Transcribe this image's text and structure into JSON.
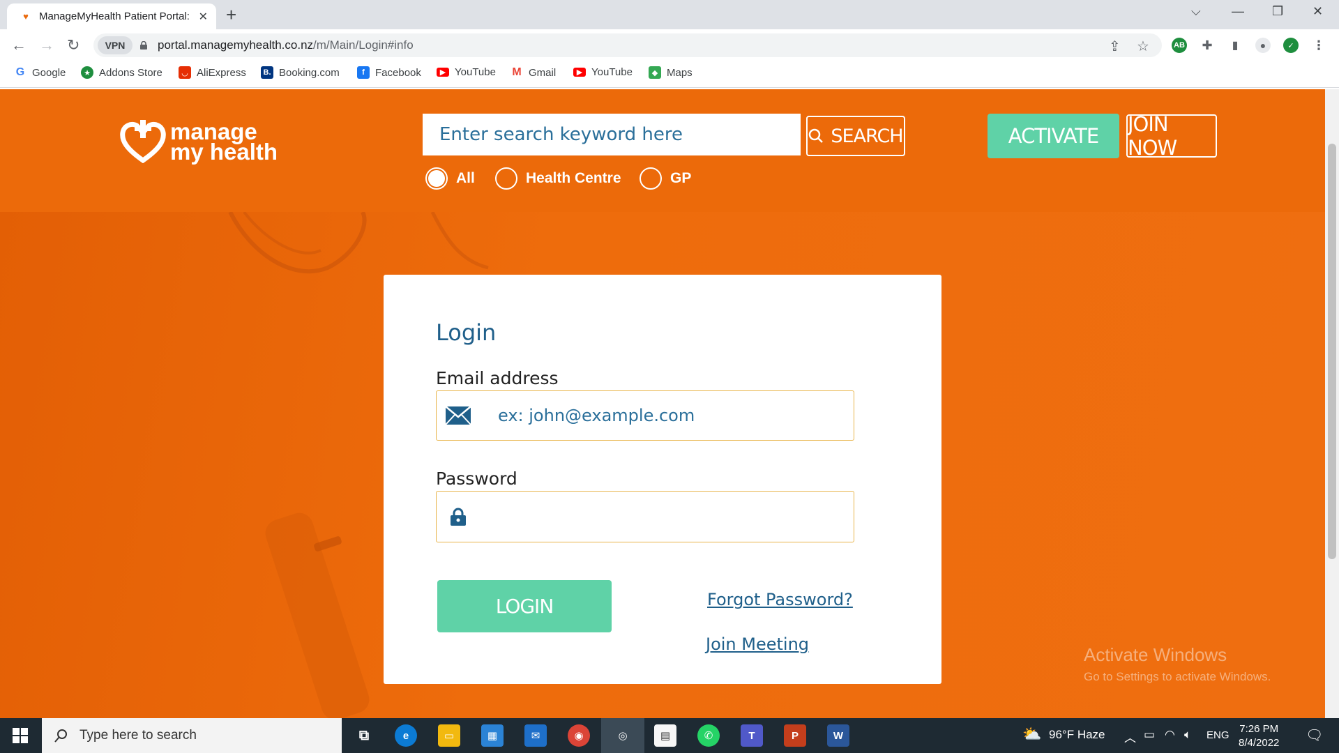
{
  "browser": {
    "tab_title": "ManageMyHealth Patient Portal:",
    "url_host": "portal.managemyhealth.co.nz",
    "url_path": "/m/Main/Login#info",
    "vpn_label": "VPN"
  },
  "bookmarks": [
    {
      "label": "Google",
      "icon": "google-icon",
      "color": "#4285f4"
    },
    {
      "label": "Addons Store",
      "icon": "addons-icon",
      "color": "#1e8e3e"
    },
    {
      "label": "AliExpress",
      "icon": "aliexpress-icon",
      "color": "#e62e04"
    },
    {
      "label": "Booking.com",
      "icon": "booking-icon",
      "color": "#003580"
    },
    {
      "label": "Facebook",
      "icon": "facebook-icon",
      "color": "#1877f2"
    },
    {
      "label": "YouTube",
      "icon": "youtube-icon",
      "color": "#ff0000"
    },
    {
      "label": "Gmail",
      "icon": "gmail-icon",
      "color": "#ea4335"
    },
    {
      "label": "YouTube",
      "icon": "youtube-icon",
      "color": "#ff0000"
    },
    {
      "label": "Maps",
      "icon": "maps-icon",
      "color": "#34a853"
    }
  ],
  "header": {
    "logo_line1": "manage",
    "logo_line2": "my health",
    "search_placeholder": "Enter search keyword here",
    "search_label": "SEARCH",
    "activate_label": "ACTIVATE",
    "join_label": "JOIN NOW",
    "filters": [
      {
        "label": "All",
        "selected": true
      },
      {
        "label": "Health Centre",
        "selected": false
      },
      {
        "label": "GP",
        "selected": false
      }
    ]
  },
  "login": {
    "title": "Login",
    "email_label": "Email address",
    "email_placeholder": "ex: john@example.com",
    "password_label": "Password",
    "password_value": "",
    "submit_label": "LOGIN",
    "forgot_label": "Forgot Password?",
    "join_meeting_label": "Join Meeting"
  },
  "watermark": {
    "title": "Activate Windows",
    "subtitle": "Go to Settings to activate Windows."
  },
  "taskbar": {
    "search_placeholder": "Type here to search",
    "weather": "96°F  Haze",
    "language": "ENG",
    "time": "7:26 PM",
    "date": "8/4/2022"
  },
  "colors": {
    "brand_orange": "#ec6a0a",
    "accent_green": "#5fd2a7",
    "link_blue": "#1f5f8a",
    "field_border": "#e8b44a"
  }
}
